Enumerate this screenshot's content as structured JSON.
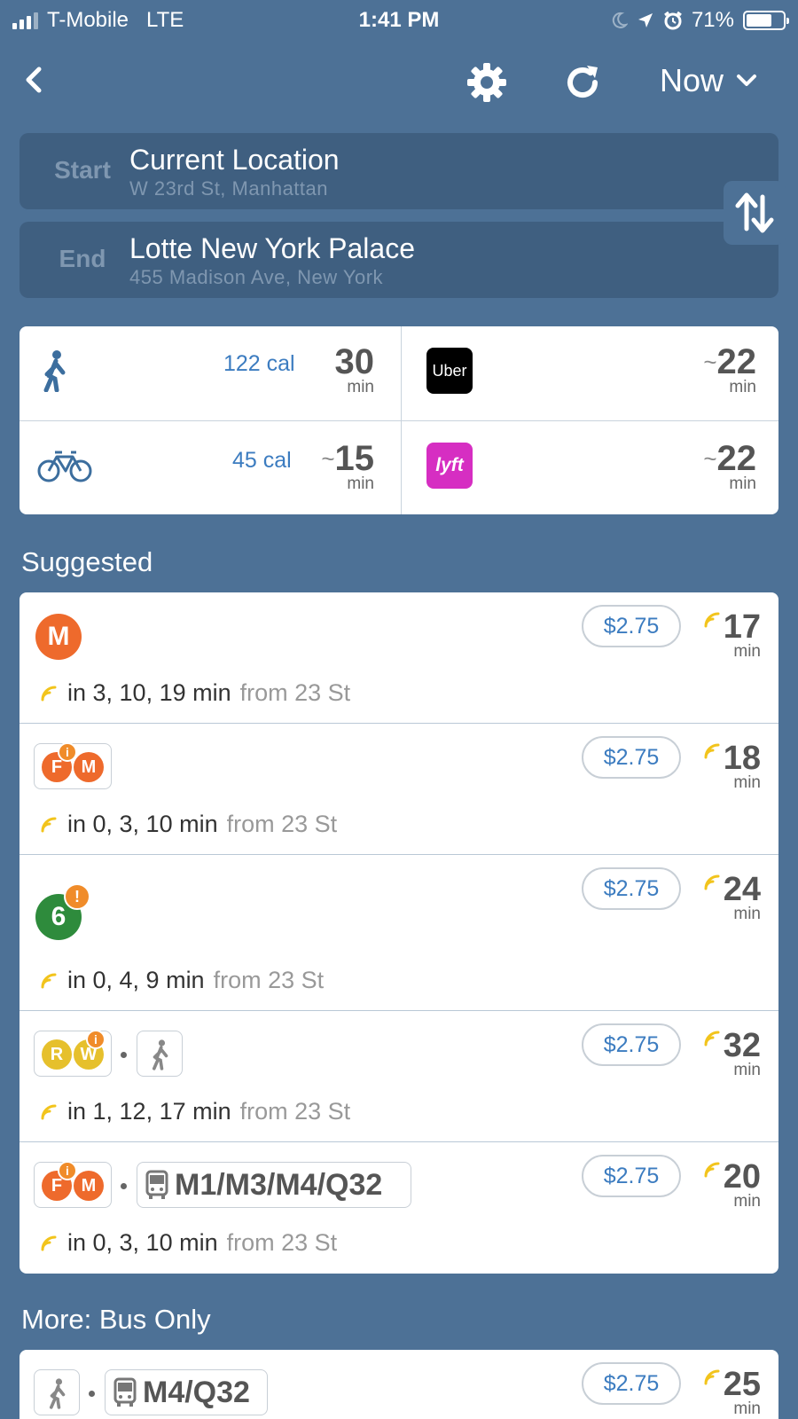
{
  "status": {
    "carrier": "T-Mobile",
    "network": "LTE",
    "time": "1:41 PM",
    "battery": "71%"
  },
  "nav": {
    "time_select": "Now"
  },
  "start": {
    "label": "Start",
    "name": "Current Location",
    "address": "W 23rd St, Manhattan"
  },
  "end": {
    "label": "End",
    "name": "Lotte New York Palace",
    "address": "455 Madison Ave, New York"
  },
  "modes": {
    "walk": {
      "cal": "122 cal",
      "minutes": "30",
      "unit": "min"
    },
    "bike": {
      "cal": "45 cal",
      "tilde": "~",
      "minutes": "15",
      "unit": "min"
    },
    "uber": {
      "logo": "Uber",
      "tilde": "~",
      "minutes": "22",
      "unit": "min"
    },
    "lyft": {
      "logo": "lyft",
      "tilde": "~",
      "minutes": "22",
      "unit": "min"
    }
  },
  "suggested": {
    "title": "Suggested",
    "routes": [
      {
        "lines": [
          "M"
        ],
        "price": "$2.75",
        "minutes": "17",
        "unit": "min",
        "departures": "in 3, 10, 19 min",
        "from": "from 23 St"
      },
      {
        "lines": [
          "F",
          "M"
        ],
        "price": "$2.75",
        "minutes": "18",
        "unit": "min",
        "departures": "in 0, 3, 10 min",
        "from": "from 23 St"
      },
      {
        "lines": [
          "6"
        ],
        "price": "$2.75",
        "minutes": "24",
        "unit": "min",
        "departures": "in 0, 4, 9 min",
        "from": "from 23 St"
      },
      {
        "lines": [
          "R",
          "W"
        ],
        "price": "$2.75",
        "minutes": "32",
        "unit": "min",
        "departures": "in 1, 12, 17 min",
        "from": "from 23 St"
      },
      {
        "lines": [
          "F",
          "M"
        ],
        "bus": "M1/M3/M4/Q32",
        "price": "$2.75",
        "minutes": "20",
        "unit": "min",
        "departures": "in 0, 3, 10 min",
        "from": "from 23 St"
      }
    ]
  },
  "bus_only": {
    "title": "More: Bus Only",
    "routes": [
      {
        "bus": "M4/Q32",
        "price": "$2.75",
        "minutes": "25",
        "unit": "min"
      }
    ]
  },
  "colors": {
    "background": "#4d7196",
    "accent_blue": "#3c7cc0",
    "line_orange": "#ee6a2c",
    "line_green": "#2e8b3c",
    "line_yellow": "#e6c02c",
    "realtime_yellow": "#f2c41c",
    "uber_black": "#000000",
    "lyft_pink": "#d62ec2"
  },
  "icons": [
    "signal-icon",
    "moon-icon",
    "location-arrow-icon",
    "alarm-icon",
    "battery-icon",
    "back-chevron-icon",
    "gear-icon",
    "refresh-icon",
    "chevron-down-icon",
    "swap-icon",
    "walk-icon",
    "bike-icon",
    "realtime-icon",
    "info-icon",
    "bus-icon"
  ]
}
